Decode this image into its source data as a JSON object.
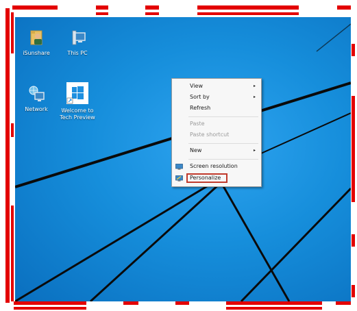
{
  "desktop": {
    "icons": [
      {
        "label": "iSunshare",
        "icon": "user-folder-icon"
      },
      {
        "label": "This PC",
        "icon": "computer-icon"
      },
      {
        "label": "Network",
        "icon": "network-icon"
      },
      {
        "label": "Welcome to Tech Preview",
        "icon": "windows-tile-icon"
      }
    ]
  },
  "context_menu": {
    "items": [
      {
        "label": "View",
        "has_submenu": true,
        "disabled": false
      },
      {
        "label": "Sort by",
        "has_submenu": true,
        "disabled": false
      },
      {
        "label": "Refresh",
        "has_submenu": false,
        "disabled": false
      },
      {
        "label": "Paste",
        "has_submenu": false,
        "disabled": true
      },
      {
        "label": "Paste shortcut",
        "has_submenu": false,
        "disabled": true
      },
      {
        "label": "New",
        "has_submenu": true,
        "disabled": false
      },
      {
        "label": "Screen resolution",
        "has_submenu": false,
        "disabled": false,
        "icon": "screen-resolution-icon"
      },
      {
        "label": "Personalize",
        "has_submenu": false,
        "disabled": false,
        "icon": "personalize-icon",
        "highlighted": true
      }
    ],
    "submenu_arrow": "▸"
  },
  "colors": {
    "desktop_blue": "#168edb",
    "highlight_border": "#c0392b",
    "frame_red": "#e30000"
  }
}
